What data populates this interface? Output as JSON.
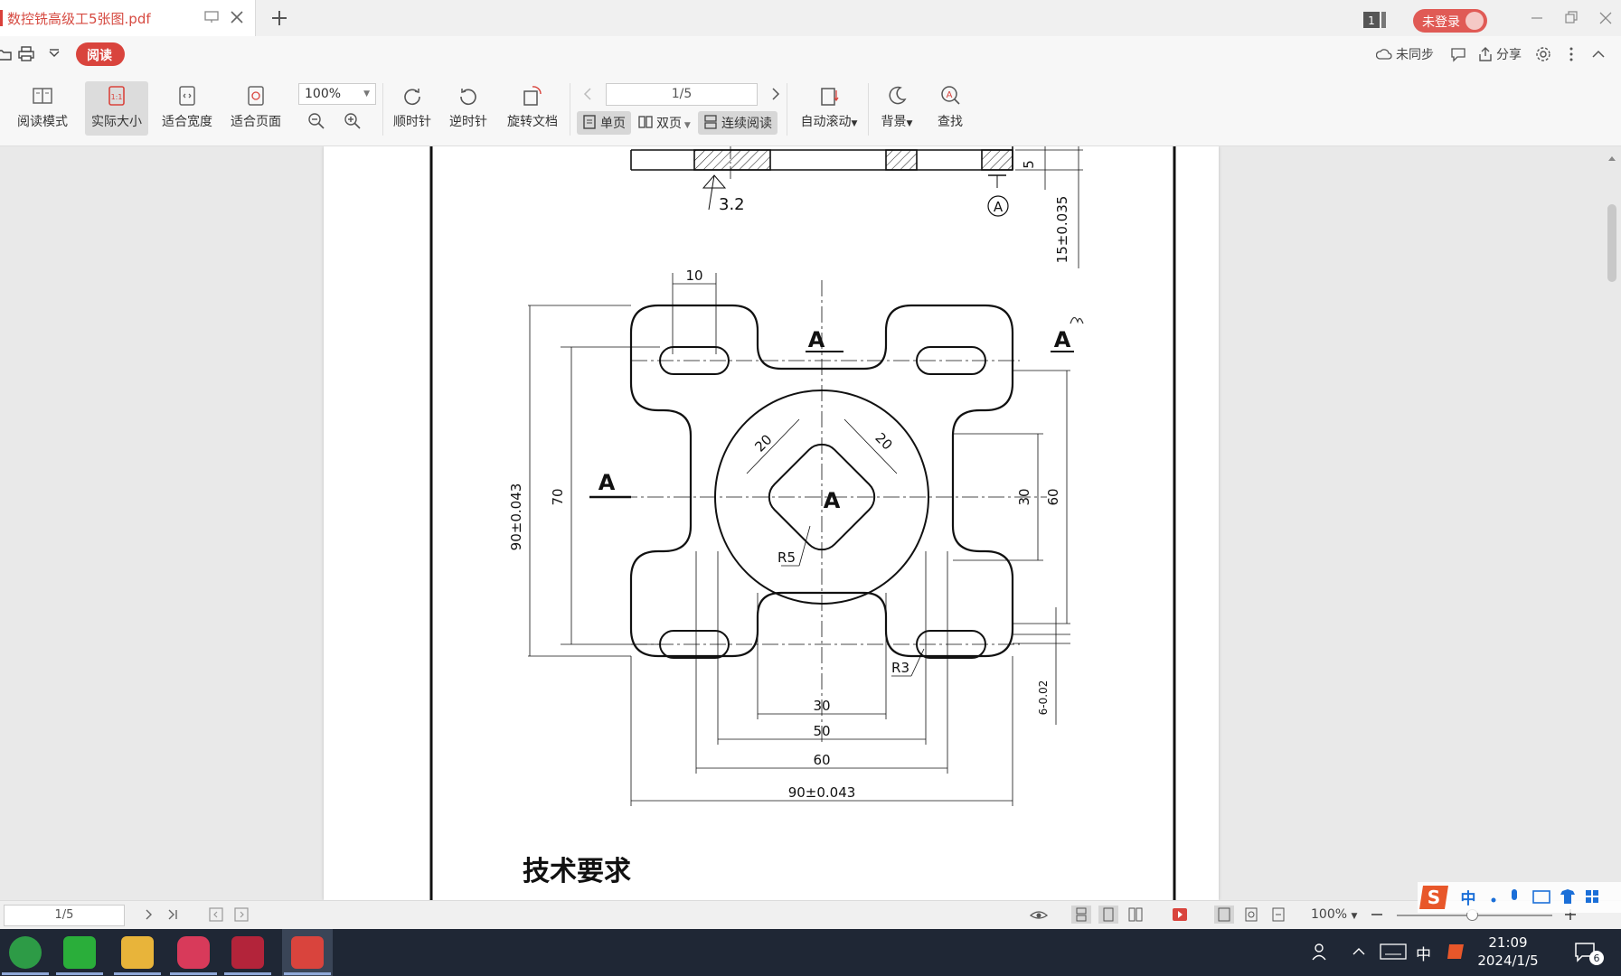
{
  "tab": {
    "title": "数控铣高级工5张图.pdf"
  },
  "header": {
    "page_badge": "1",
    "login_label": "未登录"
  },
  "menu": {
    "read_label": "阅读",
    "sync_label": "未同步",
    "share_label": "分享"
  },
  "toolbar": {
    "read_mode": "阅读模式",
    "actual_size": "实际大小",
    "fit_width": "适合宽度",
    "fit_page": "适合页面",
    "zoom_value": "100%",
    "clockwise": "顺时针",
    "counterclockwise": "逆时针",
    "rotate_doc": "旋转文档",
    "page_value": "1/5",
    "single_page": "单页",
    "double_page": "双页",
    "continuous": "连续阅读",
    "auto_scroll": "自动滚动",
    "background": "背景",
    "find": "查找"
  },
  "drawing": {
    "surface_finish": "3.2",
    "datum": "A",
    "dim_5": "5",
    "dim_15": "15±0.035",
    "dim_10": "10",
    "label_a_top": "A",
    "label_a_right": "A",
    "label_a_left": "A",
    "label_a_center": "A",
    "dim_20_left": "20",
    "dim_20_right": "20",
    "dim_90_vertical": "90±0.043",
    "dim_70": "70",
    "dim_30_vertical": "30",
    "dim_60_vertical": "60",
    "dim_r5": "R5",
    "dim_r3": "R3",
    "dim_6": "6-0.02",
    "dim_30": "30",
    "dim_50": "50",
    "dim_60": "60",
    "dim_90": "90±0.043",
    "tech_heading": "技术要求"
  },
  "statusbar": {
    "page_value": "1/5",
    "zoom_value": "100%"
  },
  "ime": {
    "mode_label": "中"
  },
  "taskbar": {
    "ime_label": "中",
    "time": "21:09",
    "date": "2024/1/5",
    "notif_count": "6"
  },
  "colors": {
    "accent": "#d9443d",
    "taskbar": "#1f2735"
  }
}
